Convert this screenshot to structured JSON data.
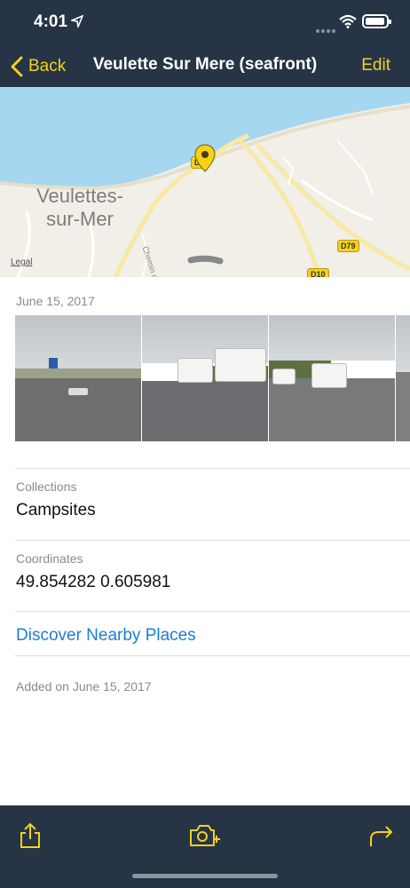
{
  "status_bar": {
    "time": "4:01"
  },
  "nav": {
    "back_label": "Back",
    "title": "Veulette Sur Mere (seafront)",
    "edit_label": "Edit"
  },
  "map": {
    "town_line1": "Veulettes-",
    "town_line2": "sur-Mer",
    "legal_label": "Legal",
    "road_labels": [
      "D79",
      "D10"
    ],
    "street_label": "Chemin d"
  },
  "photos_section": {
    "date": "June 15, 2017"
  },
  "collections": {
    "label": "Collections",
    "value": "Campsites"
  },
  "coordinates": {
    "label": "Coordinates",
    "value": "49.854282 0.605981"
  },
  "discover_link": "Discover Nearby Places",
  "added_on": "Added on June 15, 2017",
  "colors": {
    "accent": "#f5d11a",
    "bar": "#263445",
    "link": "#1b7fd4",
    "sea": "#a5d8f0"
  },
  "toolbar": {
    "icons": [
      "share-icon",
      "add-photo-icon",
      "forward-icon"
    ]
  }
}
